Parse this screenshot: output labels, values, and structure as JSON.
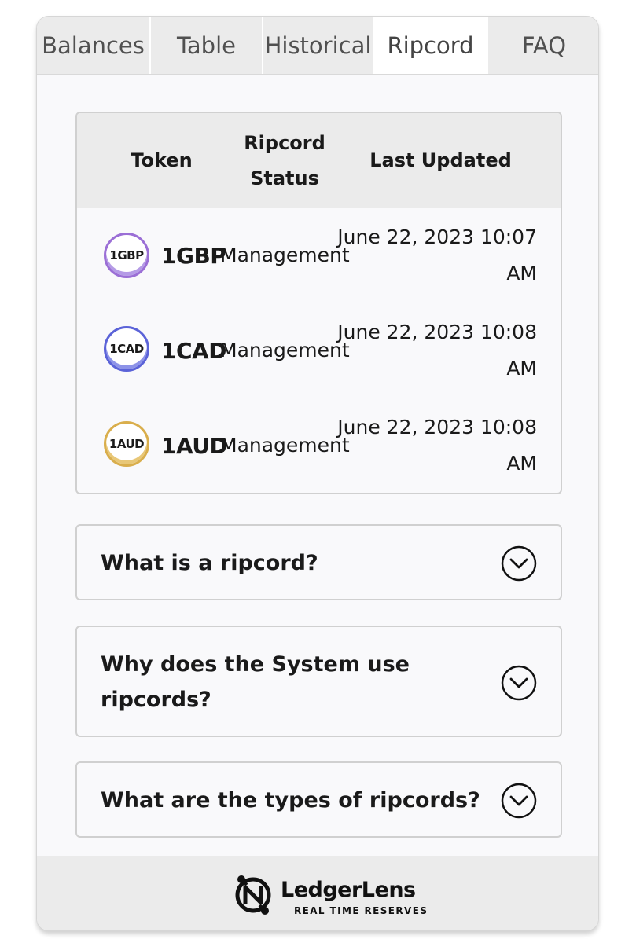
{
  "tabs": [
    {
      "label": "Balances"
    },
    {
      "label": "Table"
    },
    {
      "label": "Historical"
    },
    {
      "label": "Ripcord",
      "active": true
    },
    {
      "label": "FAQ"
    }
  ],
  "table": {
    "headers": {
      "token": "Token",
      "status_line1": "Ripcord",
      "status_line2": "Status",
      "updated": "Last Updated"
    },
    "rows": [
      {
        "icon_label": "1GBP",
        "token": "1GBP",
        "status": "Management",
        "updated_line1": "June 22, 2023 10:07",
        "updated_line2": "AM",
        "accent": "#9b6fd6"
      },
      {
        "icon_label": "1CAD",
        "token": "1CAD",
        "status": "Management",
        "updated_line1": "June 22, 2023 10:08",
        "updated_line2": "AM",
        "accent": "#5b63d8"
      },
      {
        "icon_label": "1AUD",
        "token": "1AUD",
        "status": "Management",
        "updated_line1": "June 22, 2023 10:08",
        "updated_line2": "AM",
        "accent": "#d9ae4c"
      }
    ]
  },
  "faq": [
    {
      "question": "What is a ripcord?"
    },
    {
      "question_line1": "Why does the System use",
      "question_line2": "ripcords?"
    },
    {
      "question": "What are the types of ripcords?"
    }
  ],
  "footer": {
    "brand": "LedgerLens",
    "tagline": "REAL TIME RESERVES",
    "icon": "ledgerlens-logo-icon"
  },
  "colors": {
    "tab_bg": "#ebebeb",
    "active_tab_bg": "#ffffff",
    "card_bg": "#f9f9fb",
    "border": "#d0d0d0"
  }
}
